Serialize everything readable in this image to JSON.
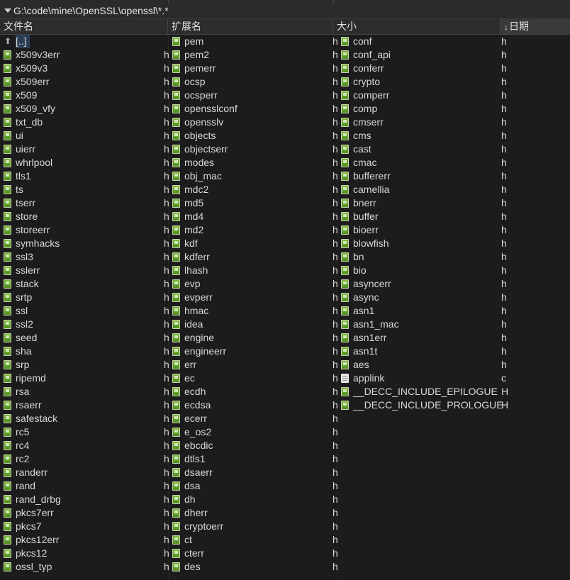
{
  "window": {
    "path": "G:\\code\\mine\\OpenSSL\\openssl\\*.*"
  },
  "header": {
    "columns": [
      {
        "label": "文件名",
        "sorted": false
      },
      {
        "label": "扩展名",
        "sorted": false
      },
      {
        "label": "大小",
        "sorted": false
      },
      {
        "label": "日期",
        "sorted": true,
        "sort_arrow": "↓"
      }
    ]
  },
  "icons": {
    "up": "up-dir-icon",
    "h": "header-file-icon",
    "c": "source-file-icon"
  },
  "columns": [
    {
      "items": [
        {
          "name": "[..]",
          "ext": "",
          "icon": "up",
          "selected": true
        },
        {
          "name": "x509v3err",
          "ext": "h",
          "icon": "h"
        },
        {
          "name": "x509v3",
          "ext": "h",
          "icon": "h"
        },
        {
          "name": "x509err",
          "ext": "h",
          "icon": "h"
        },
        {
          "name": "x509",
          "ext": "h",
          "icon": "h"
        },
        {
          "name": "x509_vfy",
          "ext": "h",
          "icon": "h"
        },
        {
          "name": "txt_db",
          "ext": "h",
          "icon": "h"
        },
        {
          "name": "ui",
          "ext": "h",
          "icon": "h"
        },
        {
          "name": "uierr",
          "ext": "h",
          "icon": "h"
        },
        {
          "name": "whrlpool",
          "ext": "h",
          "icon": "h"
        },
        {
          "name": "tls1",
          "ext": "h",
          "icon": "h"
        },
        {
          "name": "ts",
          "ext": "h",
          "icon": "h"
        },
        {
          "name": "tserr",
          "ext": "h",
          "icon": "h"
        },
        {
          "name": "store",
          "ext": "h",
          "icon": "h"
        },
        {
          "name": "storeerr",
          "ext": "h",
          "icon": "h"
        },
        {
          "name": "symhacks",
          "ext": "h",
          "icon": "h"
        },
        {
          "name": "ssl3",
          "ext": "h",
          "icon": "h"
        },
        {
          "name": "sslerr",
          "ext": "h",
          "icon": "h"
        },
        {
          "name": "stack",
          "ext": "h",
          "icon": "h"
        },
        {
          "name": "srtp",
          "ext": "h",
          "icon": "h"
        },
        {
          "name": "ssl",
          "ext": "h",
          "icon": "h"
        },
        {
          "name": "ssl2",
          "ext": "h",
          "icon": "h"
        },
        {
          "name": "seed",
          "ext": "h",
          "icon": "h"
        },
        {
          "name": "sha",
          "ext": "h",
          "icon": "h"
        },
        {
          "name": "srp",
          "ext": "h",
          "icon": "h"
        },
        {
          "name": "ripemd",
          "ext": "h",
          "icon": "h"
        },
        {
          "name": "rsa",
          "ext": "h",
          "icon": "h"
        },
        {
          "name": "rsaerr",
          "ext": "h",
          "icon": "h"
        },
        {
          "name": "safestack",
          "ext": "h",
          "icon": "h"
        },
        {
          "name": "rc5",
          "ext": "h",
          "icon": "h"
        },
        {
          "name": "rc4",
          "ext": "h",
          "icon": "h"
        },
        {
          "name": "rc2",
          "ext": "h",
          "icon": "h"
        },
        {
          "name": "randerr",
          "ext": "h",
          "icon": "h"
        },
        {
          "name": "rand",
          "ext": "h",
          "icon": "h"
        },
        {
          "name": "rand_drbg",
          "ext": "h",
          "icon": "h"
        },
        {
          "name": "pkcs7err",
          "ext": "h",
          "icon": "h"
        },
        {
          "name": "pkcs7",
          "ext": "h",
          "icon": "h"
        },
        {
          "name": "pkcs12err",
          "ext": "h",
          "icon": "h"
        },
        {
          "name": "pkcs12",
          "ext": "h",
          "icon": "h"
        },
        {
          "name": "ossl_typ",
          "ext": "h",
          "icon": "h"
        }
      ]
    },
    {
      "items": [
        {
          "name": "pem",
          "ext": "h",
          "icon": "h"
        },
        {
          "name": "pem2",
          "ext": "h",
          "icon": "h"
        },
        {
          "name": "pemerr",
          "ext": "h",
          "icon": "h"
        },
        {
          "name": "ocsp",
          "ext": "h",
          "icon": "h"
        },
        {
          "name": "ocsperr",
          "ext": "h",
          "icon": "h"
        },
        {
          "name": "opensslconf",
          "ext": "h",
          "icon": "h"
        },
        {
          "name": "opensslv",
          "ext": "h",
          "icon": "h"
        },
        {
          "name": "objects",
          "ext": "h",
          "icon": "h"
        },
        {
          "name": "objectserr",
          "ext": "h",
          "icon": "h"
        },
        {
          "name": "modes",
          "ext": "h",
          "icon": "h"
        },
        {
          "name": "obj_mac",
          "ext": "h",
          "icon": "h"
        },
        {
          "name": "mdc2",
          "ext": "h",
          "icon": "h"
        },
        {
          "name": "md5",
          "ext": "h",
          "icon": "h"
        },
        {
          "name": "md4",
          "ext": "h",
          "icon": "h"
        },
        {
          "name": "md2",
          "ext": "h",
          "icon": "h"
        },
        {
          "name": "kdf",
          "ext": "h",
          "icon": "h"
        },
        {
          "name": "kdferr",
          "ext": "h",
          "icon": "h"
        },
        {
          "name": "lhash",
          "ext": "h",
          "icon": "h"
        },
        {
          "name": "evp",
          "ext": "h",
          "icon": "h"
        },
        {
          "name": "evperr",
          "ext": "h",
          "icon": "h"
        },
        {
          "name": "hmac",
          "ext": "h",
          "icon": "h"
        },
        {
          "name": "idea",
          "ext": "h",
          "icon": "h"
        },
        {
          "name": "engine",
          "ext": "h",
          "icon": "h"
        },
        {
          "name": "engineerr",
          "ext": "h",
          "icon": "h"
        },
        {
          "name": "err",
          "ext": "h",
          "icon": "h"
        },
        {
          "name": "ec",
          "ext": "h",
          "icon": "h"
        },
        {
          "name": "ecdh",
          "ext": "h",
          "icon": "h"
        },
        {
          "name": "ecdsa",
          "ext": "h",
          "icon": "h"
        },
        {
          "name": "ecerr",
          "ext": "h",
          "icon": "h"
        },
        {
          "name": "e_os2",
          "ext": "h",
          "icon": "h"
        },
        {
          "name": "ebcdic",
          "ext": "h",
          "icon": "h"
        },
        {
          "name": "dtls1",
          "ext": "h",
          "icon": "h"
        },
        {
          "name": "dsaerr",
          "ext": "h",
          "icon": "h"
        },
        {
          "name": "dsa",
          "ext": "h",
          "icon": "h"
        },
        {
          "name": "dh",
          "ext": "h",
          "icon": "h"
        },
        {
          "name": "dherr",
          "ext": "h",
          "icon": "h"
        },
        {
          "name": "cryptoerr",
          "ext": "h",
          "icon": "h"
        },
        {
          "name": "ct",
          "ext": "h",
          "icon": "h"
        },
        {
          "name": "cterr",
          "ext": "h",
          "icon": "h"
        },
        {
          "name": "des",
          "ext": "h",
          "icon": "h"
        }
      ]
    },
    {
      "items": [
        {
          "name": "conf",
          "ext": "h",
          "icon": "h"
        },
        {
          "name": "conf_api",
          "ext": "h",
          "icon": "h"
        },
        {
          "name": "conferr",
          "ext": "h",
          "icon": "h"
        },
        {
          "name": "crypto",
          "ext": "h",
          "icon": "h"
        },
        {
          "name": "comperr",
          "ext": "h",
          "icon": "h"
        },
        {
          "name": "comp",
          "ext": "h",
          "icon": "h"
        },
        {
          "name": "cmserr",
          "ext": "h",
          "icon": "h"
        },
        {
          "name": "cms",
          "ext": "h",
          "icon": "h"
        },
        {
          "name": "cast",
          "ext": "h",
          "icon": "h"
        },
        {
          "name": "cmac",
          "ext": "h",
          "icon": "h"
        },
        {
          "name": "buffererr",
          "ext": "h",
          "icon": "h"
        },
        {
          "name": "camellia",
          "ext": "h",
          "icon": "h"
        },
        {
          "name": "bnerr",
          "ext": "h",
          "icon": "h"
        },
        {
          "name": "buffer",
          "ext": "h",
          "icon": "h"
        },
        {
          "name": "bioerr",
          "ext": "h",
          "icon": "h"
        },
        {
          "name": "blowfish",
          "ext": "h",
          "icon": "h"
        },
        {
          "name": "bn",
          "ext": "h",
          "icon": "h"
        },
        {
          "name": "bio",
          "ext": "h",
          "icon": "h"
        },
        {
          "name": "asyncerr",
          "ext": "h",
          "icon": "h"
        },
        {
          "name": "async",
          "ext": "h",
          "icon": "h"
        },
        {
          "name": "asn1",
          "ext": "h",
          "icon": "h"
        },
        {
          "name": "asn1_mac",
          "ext": "h",
          "icon": "h"
        },
        {
          "name": "asn1err",
          "ext": "h",
          "icon": "h"
        },
        {
          "name": "asn1t",
          "ext": "h",
          "icon": "h"
        },
        {
          "name": "aes",
          "ext": "h",
          "icon": "h"
        },
        {
          "name": "applink",
          "ext": "c",
          "icon": "c"
        },
        {
          "name": "__DECC_INCLUDE_EPILOGUE",
          "ext": "H",
          "icon": "h"
        },
        {
          "name": "__DECC_INCLUDE_PROLOGUE",
          "ext": "H",
          "icon": "h"
        }
      ]
    }
  ]
}
